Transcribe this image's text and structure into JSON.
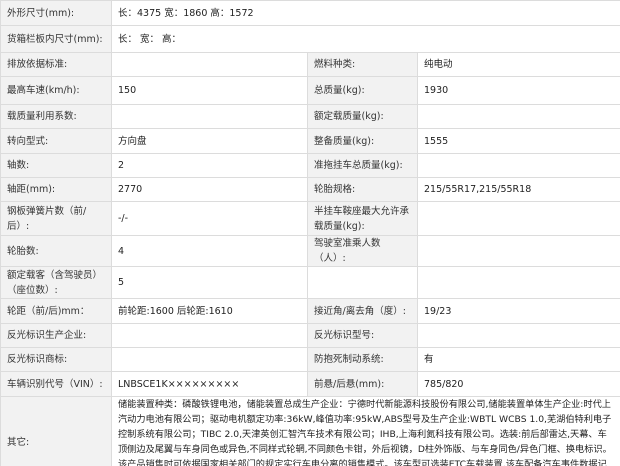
{
  "rows": [
    {
      "type": "full",
      "label": "外形尺寸(mm):",
      "value": "长：4375 宽：1860 高：1572"
    },
    {
      "type": "full",
      "label": "货箱栏板内尺寸(mm):",
      "value": "长： 宽： 高："
    },
    {
      "type": "pair",
      "label1": "排放依据标准:",
      "value1": "",
      "label2": "燃料种类:",
      "value2": "纯电动"
    },
    {
      "type": "pair",
      "label1": "最高车速(km/h):",
      "value1": "150",
      "label2": "总质量(kg):",
      "value2": "1930"
    },
    {
      "type": "pair",
      "label1": "载质量利用系数:",
      "value1": "",
      "label2": "额定载质量(kg):",
      "value2": ""
    },
    {
      "type": "pair",
      "label1": "转向型式:",
      "value1": "方向盘",
      "label2": "整备质量(kg):",
      "value2": "1555"
    },
    {
      "type": "pair",
      "label1": "轴数:",
      "value1": "2",
      "label2": "准拖挂车总质量(kg):",
      "value2": ""
    },
    {
      "type": "pair",
      "label1": "轴距(mm):",
      "value1": "2770",
      "label2": "轮胎规格:",
      "value2": "215/55R17,215/55R18"
    },
    {
      "type": "pair",
      "label1": "钢板弹簧片数（前/后）:",
      "value1": "-/-",
      "label2": "半挂车鞍座最大允许承载质量(kg):",
      "value2": ""
    },
    {
      "type": "pair",
      "label1": "轮胎数:",
      "value1": "4",
      "label2": "驾驶室准乘人数（人）:",
      "value2": ""
    },
    {
      "type": "pair",
      "label1": "额定载客（含驾驶员）（座位数）:",
      "value1": "5",
      "label2": "",
      "value2": ""
    },
    {
      "type": "pair",
      "label1": "轮距（前/后)mm：",
      "value1": "前轮距:1600 后轮距:1610",
      "label2": "接近角/离去角（度）:",
      "value2": "19/23"
    },
    {
      "type": "pair",
      "label1": "反光标识生产企业:",
      "value1": "",
      "label2": "反光标识型号:",
      "value2": ""
    },
    {
      "type": "pair",
      "label1": "反光标识商标:",
      "value1": "",
      "label2": "防抱死制动系统:",
      "value2": "有"
    },
    {
      "type": "pair",
      "label1": "车辆识别代号（VIN）:",
      "value1": "LNBSCE1K×××××××××",
      "label2": "前悬/后悬(mm):",
      "value2": "785/820"
    },
    {
      "type": "other",
      "label": "其它:",
      "value": "储能装置种类：磷酸铁锂电池，储能装置总成生产企业：宁德时代新能源科技股份有限公司,储能装置单体生产企业:时代上汽动力电池有限公司；驱动电机额定功率:36kW,峰值功率:95kW,ABS型号及生产企业:WBTL WCBS 1.0,芜湖伯特利电子控制系统有限公司；TIBC 2.0,天津英创汇智汽车技术有限公司；IHB,上海利氮科技有限公司。选装:前后部雷达,天幕、车顶侧边及尾翼与车身同色或异色,不同样式轮辋,不同颜色卡钳，外后视镜，D柱外饰版、与车身同色/异色门框、换电标识。该产品销售时可依据国家相关部门的规定实行车电分离的销售模式。该车型可选装ETC车载装置,该车配备汽车事件数据记录系统(EDR)。"
    }
  ]
}
